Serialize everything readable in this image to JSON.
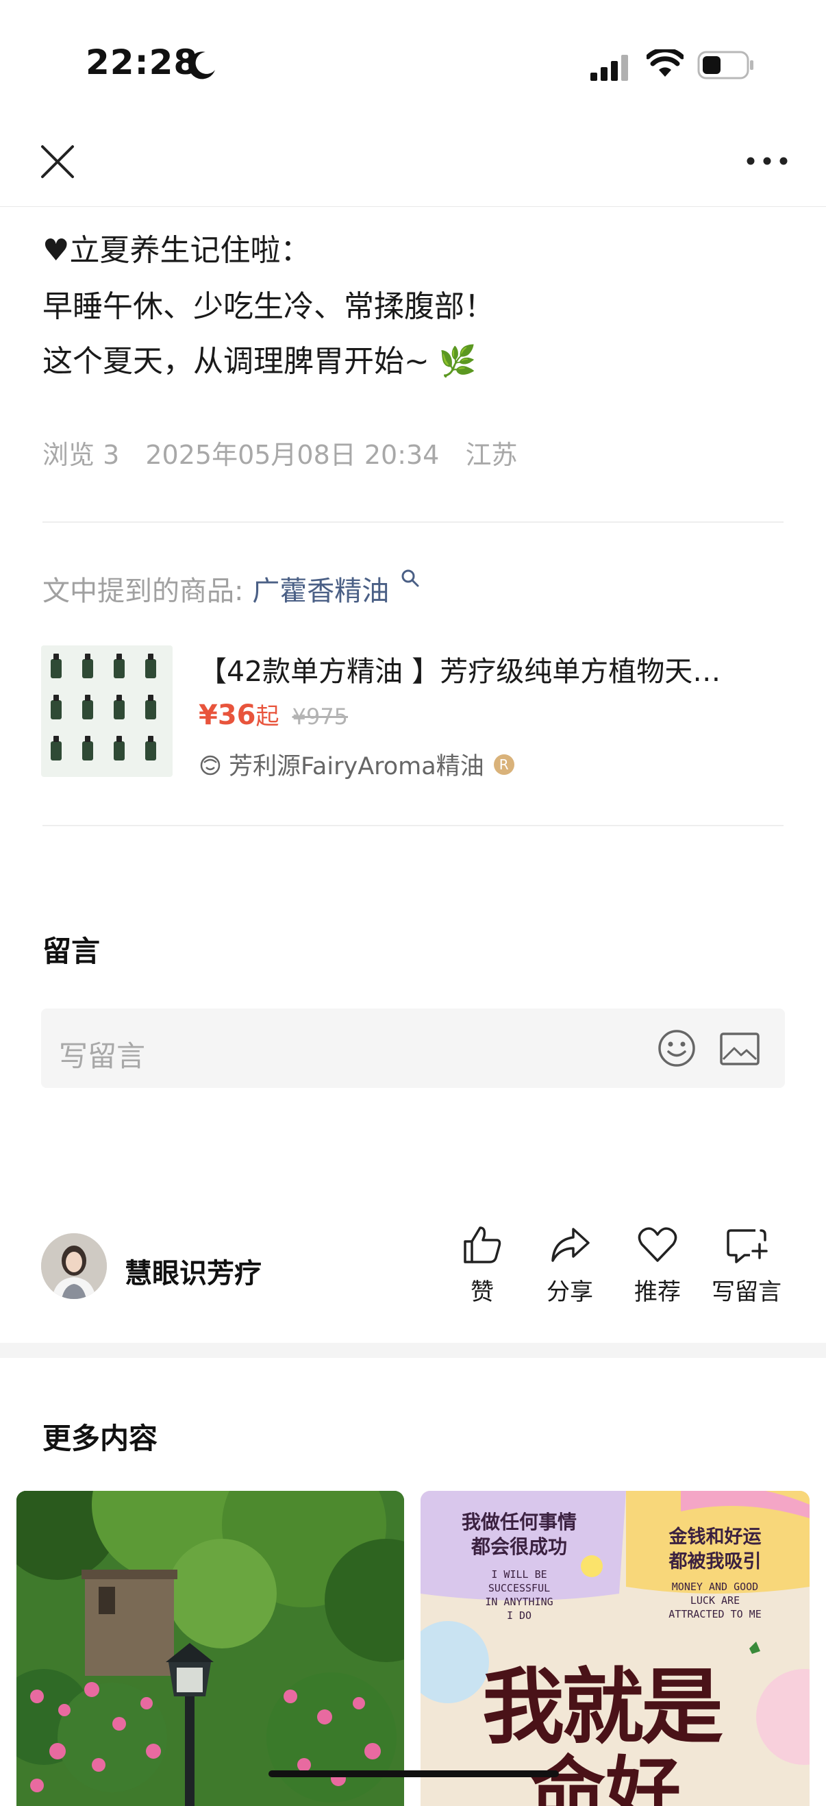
{
  "status_bar": {
    "time": "22:28"
  },
  "post": {
    "lines": [
      "♥立夏养生记住啦：",
      "早睡午休、少吃生冷、常揉腹部！",
      "这个夏天，从调理脾胃开始~ 🌿"
    ],
    "views": "浏览 3",
    "datetime": "2025年05月08日 20:34",
    "location": "江苏"
  },
  "mentioned": {
    "label": "文中提到的商品:",
    "product_link": "广藿香精油"
  },
  "product": {
    "title": "【42款单方精油 】芳疗级纯单方植物天…",
    "price": "¥36",
    "price_suffix": "起",
    "original_price": "¥975",
    "shop": "芳利源FairyAroma精油",
    "badge": "R"
  },
  "comments": {
    "title": "留言",
    "placeholder": "写留言"
  },
  "author": {
    "name": "慧眼识芳疗"
  },
  "actions": {
    "like": "赞",
    "share": "分享",
    "recommend": "推荐",
    "write": "写留言"
  },
  "more": {
    "title": "更多内容"
  },
  "cards": {
    "right": {
      "l1": "我做任何事情",
      "l2": "都会很成功",
      "e1": "I WILL BE",
      "e2": "SUCCESSFUL",
      "e3": "IN ANYTHING",
      "e4": "I DO",
      "r1": "金钱和好运",
      "r2": "都被我吸引",
      "re1": "MONEY AND GOOD",
      "re2": "LUCK ARE",
      "re3": "ATTRACTED TO ME",
      "big": "我就是",
      "big2": "命好"
    }
  },
  "colors": {
    "price": "#e8543c",
    "link": "#4a5f85",
    "muted": "#a8a8a8"
  }
}
